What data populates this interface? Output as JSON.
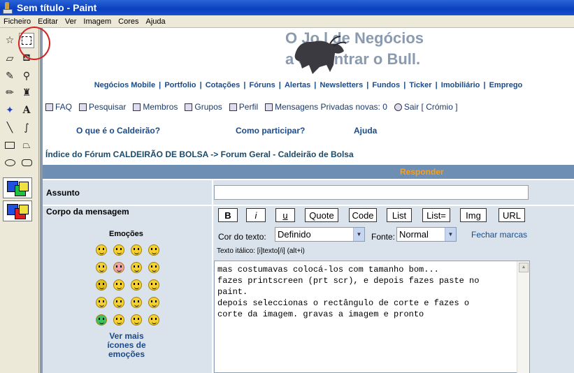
{
  "window": {
    "title": "Sem título - Paint"
  },
  "menu": [
    "Ficheiro",
    "Editar",
    "Ver",
    "Imagem",
    "Cores",
    "Ajuda"
  ],
  "banner": {
    "line1": "O Jo   l de Negócios",
    "line2": "         a encontrar o Bull."
  },
  "navlinks": [
    "Negócios Mobile",
    "Portfolio",
    "Cotações",
    "Fóruns",
    "Alertas",
    "Newsletters",
    "Fundos",
    "Ticker",
    "Imobiliário",
    "Emprego"
  ],
  "toplinks": {
    "faq": "FAQ",
    "search": "Pesquisar",
    "members": "Membros",
    "groups": "Grupos",
    "profile": "Perfil",
    "messages": "Mensagens Privadas novas: 0",
    "logout": "Sair [ Crómio ]"
  },
  "help": {
    "what": "O que é o Caldeirão?",
    "how": "Como participar?",
    "help": "Ajuda"
  },
  "breadcrumb": {
    "index": "Índice do Fórum CALDEIRÃO DE BOLSA",
    "arrow": "->",
    "forum": "Forum Geral - Caldeirão de Bolsa"
  },
  "reply": {
    "header": "Responder",
    "subject_label": "Assunto",
    "body_label": "Corpo da mensagem",
    "subject_value": ""
  },
  "format_buttons": {
    "b": "B",
    "i": "i",
    "u": "u",
    "quote": "Quote",
    "code": "Code",
    "list": "List",
    "list_eq": "List=",
    "img": "Img",
    "url": "URL"
  },
  "text_color": {
    "label": "Cor do texto:",
    "value": "Definido"
  },
  "font": {
    "label": "Fonte:",
    "value": "Normal"
  },
  "close_tags": "Fechar marcas",
  "hint": "Texto itálico: [i]texto[/i]  (alt+i)",
  "emoticons": {
    "title": "Emoções",
    "more": "Ver mais ícones de emoções"
  },
  "message_text": "mas costumavas colocá-los com tamanho bom...\nfazes printscreen (prt scr), e depois fazes paste no\npaint.\ndepois seleccionas o rectângulo de corte e fazes o\ncorte da imagem. gravas a imagem e pronto",
  "colors": {
    "title_bar": "#0a3fc0",
    "nav_link": "#1a4a8a",
    "reply_header_bg": "#6e8fb3",
    "reply_header_text": "#f4a020",
    "row_bg": "#dae3ec"
  }
}
